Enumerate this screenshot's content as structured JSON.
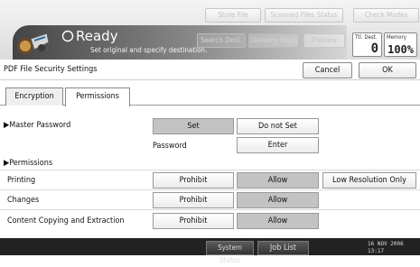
{
  "header": {
    "top_buttons": [
      "Store File",
      "Scanned Files Status",
      "Check Modes"
    ],
    "mode_buttons": [
      "Search Dest.",
      "Delivery Dest.",
      "Preview"
    ],
    "status": "Ready",
    "status_message": "Set original and specify destination.",
    "total_dest_label": "Ttl. Dest.",
    "total_dest_value": "0",
    "memory_label": "Memory",
    "memory_value": "100%"
  },
  "dialog": {
    "title": "PDF File Security Settings",
    "cancel_label": "Cancel",
    "ok_label": "OK",
    "tabs": [
      "Encryption",
      "Permissions"
    ],
    "active_tab": "Permissions"
  },
  "master_password": {
    "label": "▶Master Password",
    "set_label": "Set",
    "do_not_set_label": "Do not Set",
    "selected": "Set",
    "password_label": "Password",
    "enter_label": "Enter"
  },
  "permissions": {
    "heading": "▶Permissions",
    "rows": [
      {
        "label": "Printing",
        "prohibit": "Prohibit",
        "allow": "Allow",
        "extra": "Low Resolution Only",
        "selected": "Allow"
      },
      {
        "label": "Changes",
        "prohibit": "Prohibit",
        "allow": "Allow",
        "selected": "Allow"
      },
      {
        "label": "Content Copying and Extraction",
        "prohibit": "Prohibit",
        "allow": "Allow",
        "selected": "Allow"
      }
    ]
  },
  "footer": {
    "system_status": "System Status",
    "job_list": "Job List",
    "date": "16 NOV  2006",
    "time": "13:17"
  }
}
